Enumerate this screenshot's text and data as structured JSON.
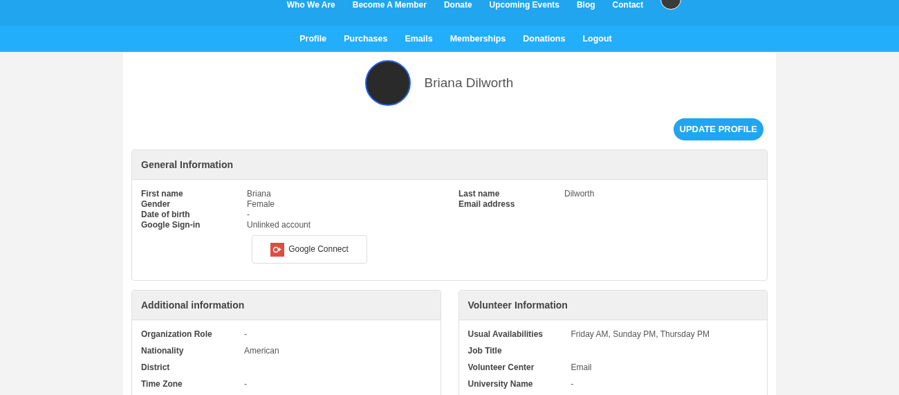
{
  "top_nav": [
    "Who We Are",
    "Become A Member",
    "Donate",
    "Upcoming Events",
    "Blog",
    "Contact"
  ],
  "sub_nav": [
    "Profile",
    "Purchases",
    "Emails",
    "Memberships",
    "Donations",
    "Logout"
  ],
  "profile": {
    "name": "Briana Dilworth",
    "update_button": "UPDATE PROFILE"
  },
  "general": {
    "title": "General Information",
    "left": [
      {
        "label": "First name",
        "value": "Briana"
      },
      {
        "label": "Gender",
        "value": "Female"
      },
      {
        "label": "Date of birth",
        "value": "-"
      },
      {
        "label": "Google Sign-in",
        "value": "Unlinked account"
      }
    ],
    "right": [
      {
        "label": "Last name",
        "value": "Dilworth"
      },
      {
        "label": "Email address"
      }
    ],
    "google_button": "Google Connect"
  },
  "additional": {
    "title": "Additional information",
    "rows": [
      {
        "label": "Organization Role",
        "value": "-"
      },
      {
        "label": "Nationality",
        "value": "American"
      },
      {
        "label": "District"
      },
      {
        "label": "Time Zone",
        "value": "-"
      }
    ]
  },
  "volunteer": {
    "title": "Volunteer Information",
    "rows": [
      {
        "label": "Usual Availabilities",
        "value": "Friday AM, Sunday PM, Thursday PM"
      },
      {
        "label": "Job Title"
      },
      {
        "label": "Volunteer Center",
        "value": "Email"
      },
      {
        "label": "University Name",
        "value": "-"
      }
    ]
  }
}
